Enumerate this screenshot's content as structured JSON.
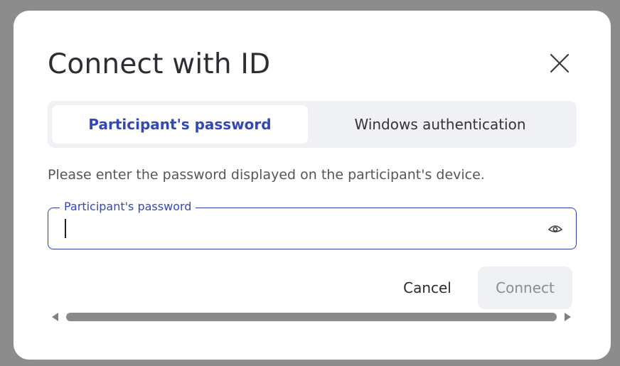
{
  "dialog": {
    "title": "Connect with ID",
    "close_icon": "close-icon",
    "tabs": [
      {
        "label": "Participant's password",
        "active": true
      },
      {
        "label": "Windows authentication",
        "active": false
      }
    ],
    "instruction": "Please enter the password displayed on the participant's device.",
    "password_field": {
      "label": "Participant's password",
      "value": "",
      "eye_icon": "eye-icon"
    },
    "buttons": {
      "cancel": "Cancel",
      "connect": "Connect"
    }
  },
  "colors": {
    "accent": "#3347b8",
    "field_border": "#2e3fa8",
    "tab_bar_bg": "#f0f1f5",
    "disabled_button_bg": "#eef0f4",
    "disabled_button_text": "#8a8d96",
    "backdrop": "#8c8c8c"
  }
}
